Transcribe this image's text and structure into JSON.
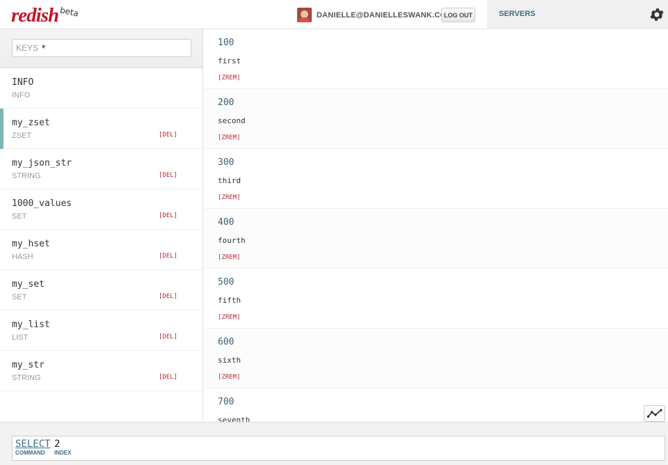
{
  "header": {
    "logo_text": "redish",
    "logo_badge": "beta",
    "user_email": "DANIELLE@DANIELLESWANK.COM",
    "logout_label": "LOG OUT",
    "servers_label": "SERVERS",
    "accent_color": "#c0182c"
  },
  "sidebar": {
    "search_label": "KEYS",
    "search_value": "*",
    "keys": [
      {
        "name": "INFO",
        "type": "INFO",
        "del": ""
      },
      {
        "name": "my_zset",
        "type": "ZSET",
        "del": "[DEL]"
      },
      {
        "name": "my_json_str",
        "type": "STRING",
        "del": "[DEL]"
      },
      {
        "name": "1000_values",
        "type": "SET",
        "del": "[DEL]"
      },
      {
        "name": "my_hset",
        "type": "HASH",
        "del": "[DEL]"
      },
      {
        "name": "my_set",
        "type": "SET",
        "del": "[DEL]"
      },
      {
        "name": "my_list",
        "type": "LIST",
        "del": "[DEL]"
      },
      {
        "name": "my_str",
        "type": "STRING",
        "del": "[DEL]"
      }
    ],
    "active_key": "my_zset"
  },
  "main": {
    "members": [
      {
        "score": "100",
        "value": "first",
        "action": "[ZREM]"
      },
      {
        "score": "200",
        "value": "second",
        "action": "[ZREM]"
      },
      {
        "score": "300",
        "value": "third",
        "action": "[ZREM]"
      },
      {
        "score": "400",
        "value": "fourth",
        "action": "[ZREM]"
      },
      {
        "score": "500",
        "value": "fifth",
        "action": "[ZREM]"
      },
      {
        "score": "600",
        "value": "sixth",
        "action": "[ZREM]"
      },
      {
        "score": "700",
        "value": "seventh",
        "action": ""
      }
    ]
  },
  "command_bar": {
    "command": "SELECT",
    "command_label": "COMMAND",
    "argument": "2",
    "argument_label": "INDEX"
  },
  "icons": {
    "settings": "gear-icon",
    "chart": "line-chart-icon",
    "avatar": "user-avatar"
  }
}
